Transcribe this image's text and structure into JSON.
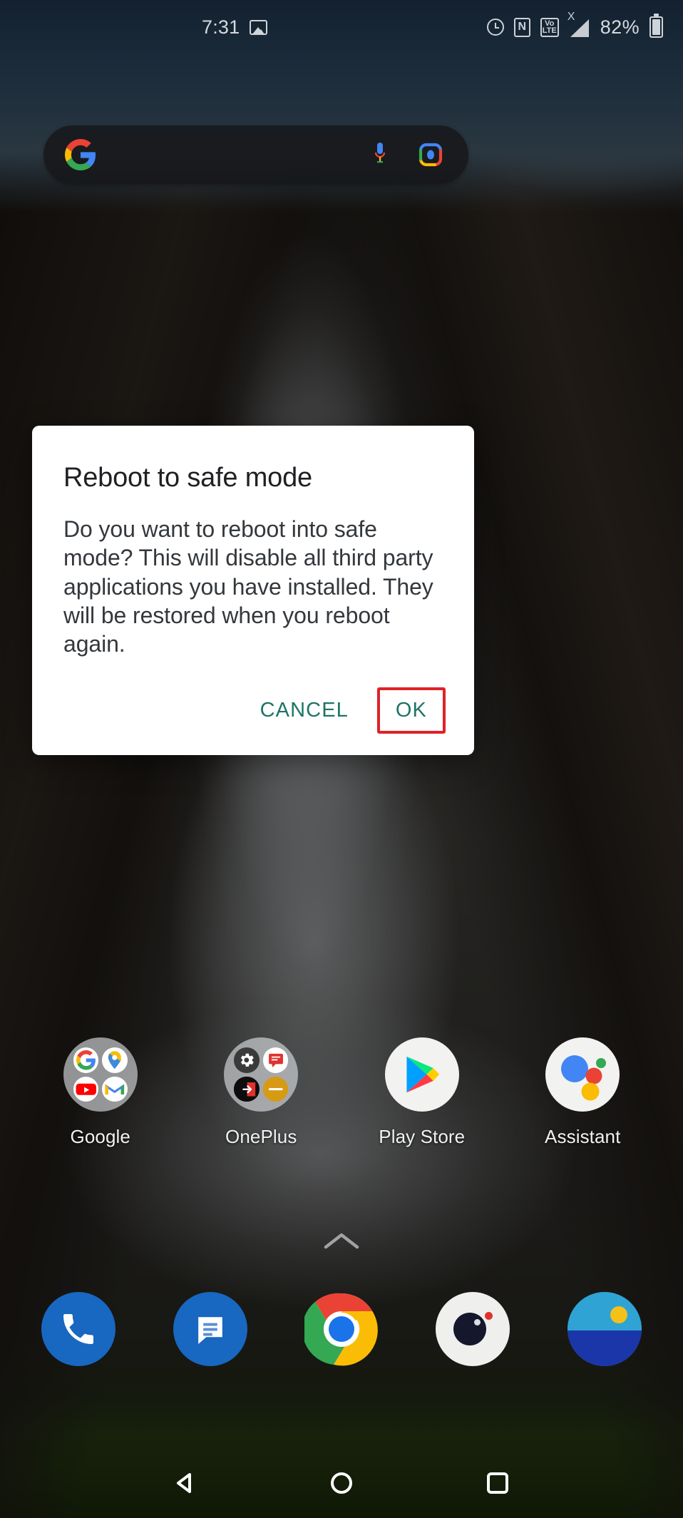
{
  "status_bar": {
    "clock": "7:31",
    "battery_percent": "82%",
    "icons_left": [
      "photo-icon"
    ],
    "icons_right": [
      "alarm-icon",
      "nfc-icon",
      "volte-icon",
      "signal-icon",
      "battery-icon"
    ],
    "nfc_glyph": "N",
    "volte_top": "Vo",
    "volte_bottom": "LTE",
    "signal_superscript": "X"
  },
  "search_widget": {
    "name": "google-search-bar",
    "left_icon": "google-g-logo",
    "mic_icon": "microphone-icon",
    "lens_icon": "google-lens-camera-icon",
    "placeholder": ""
  },
  "app_grid": [
    {
      "label": "Google",
      "type": "folder",
      "icon": "google-folder-icon"
    },
    {
      "label": "OnePlus",
      "type": "folder",
      "icon": "oneplus-folder-icon"
    },
    {
      "label": "Play Store",
      "type": "app",
      "icon": "play-store-icon"
    },
    {
      "label": "Assistant",
      "type": "app",
      "icon": "google-assistant-icon"
    }
  ],
  "drawer": {
    "chevron": "chevron-up-icon"
  },
  "dock": [
    {
      "label": "Phone",
      "icon": "phone-icon"
    },
    {
      "label": "Messages",
      "icon": "messages-icon"
    },
    {
      "label": "Chrome",
      "icon": "chrome-icon"
    },
    {
      "label": "Camera",
      "icon": "camera-icon"
    },
    {
      "label": "Gallery",
      "icon": "gallery-icon"
    }
  ],
  "nav_bar": [
    {
      "label": "Back",
      "icon": "back-triangle-icon"
    },
    {
      "label": "Home",
      "icon": "home-circle-icon"
    },
    {
      "label": "Recents",
      "icon": "recents-square-icon"
    }
  ],
  "dialog": {
    "title": "Reboot to safe mode",
    "message": "Do you want to reboot into safe mode? This will disable all third party applications you have installed. They will be restored when you reboot again.",
    "cancel_label": "CANCEL",
    "ok_label": "OK",
    "accent_color": "#1d7567",
    "highlight_color": "#e02128",
    "background_color": "#ffffff"
  }
}
